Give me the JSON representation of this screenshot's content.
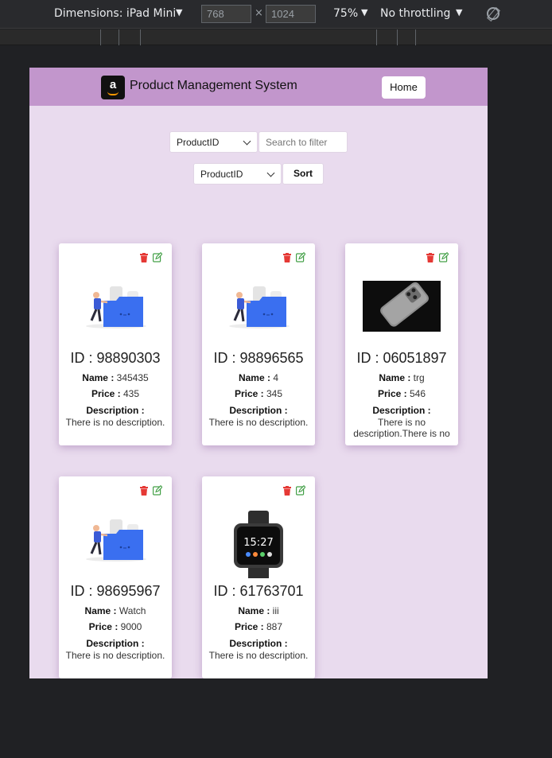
{
  "devtools": {
    "dimensions_label": "Dimensions: iPad Mini",
    "width_value": "768",
    "height_value": "1024",
    "times": "×",
    "zoom": "75%",
    "throttling": "No throttling",
    "caret": "▼"
  },
  "nav": {
    "logo_letter": "a",
    "title": "Product Management System",
    "home_label": "Home"
  },
  "controls": {
    "filter_select": "ProductID",
    "search_placeholder": "Search to filter",
    "sort_select": "ProductID",
    "sort_label": "Sort"
  },
  "labels": {
    "id": "ID :",
    "name": "Name :",
    "price": "Price :",
    "description": "Description :"
  },
  "products": [
    {
      "id": "98890303",
      "name": "345435",
      "price": "435",
      "description": "There is no description.",
      "image": "folder-illustration"
    },
    {
      "id": "98896565",
      "name": "4",
      "price": "345",
      "description": "There is no description.",
      "image": "folder-illustration"
    },
    {
      "id": "06051897",
      "name": "trg",
      "price": "546",
      "description": "There is no description.There is no",
      "image": "iphone-photo"
    },
    {
      "id": "98695967",
      "name": "Watch",
      "price": "9000",
      "description": "There is no description.",
      "image": "folder-illustration"
    },
    {
      "id": "61763701",
      "name": "iii",
      "price": "887",
      "description": "There is no description.",
      "image": "smartwatch-photo",
      "watch_time": "15:27"
    }
  ],
  "colors": {
    "nav_bg": "#c296cc",
    "page_bg": "#e9dbee",
    "trash": "#e53935",
    "edit": "#43a047",
    "folder": "#3a6ff0"
  }
}
